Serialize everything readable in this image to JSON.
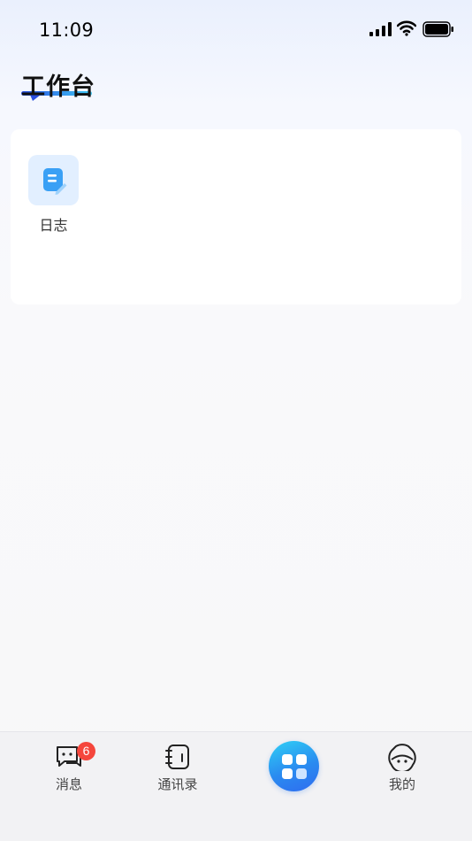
{
  "status_bar": {
    "time": "11:09",
    "icons": [
      "signal-icon",
      "wifi-icon",
      "battery-icon"
    ]
  },
  "header": {
    "title": "工作台"
  },
  "apps": [
    {
      "label": "日志",
      "icon": "log-edit-icon"
    }
  ],
  "tab_bar": {
    "items": [
      {
        "label": "消息",
        "icon": "chat-icon",
        "badge": "6"
      },
      {
        "label": "通讯录",
        "icon": "contacts-book-icon"
      },
      {
        "label": "",
        "icon": "workbench-grid-icon"
      },
      {
        "label": "我的",
        "icon": "cat-face-icon"
      }
    ]
  },
  "colors": {
    "accent": "#2a8bf0",
    "badge": "#f5463c",
    "tile_bg": "#e2efff",
    "icon_blue": "#3aa0f5"
  }
}
